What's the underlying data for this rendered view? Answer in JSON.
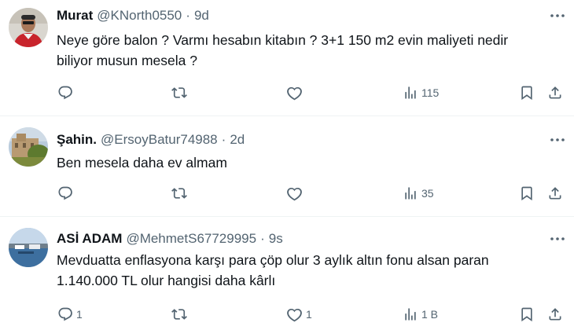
{
  "tweets": [
    {
      "name": "Murat",
      "handle": "@KNorth0550",
      "time": "9d",
      "lines": [
        "Neye göre balon ? Varmı hesabın kitabın ? 3+1 150 m2 evin maliyeti nedir",
        "biliyor musun mesela ?"
      ],
      "reply_count": "",
      "views": "115",
      "avatar": "person-red-shirt"
    },
    {
      "name": "Şahin.",
      "handle": "@ErsoyBatur74988",
      "time": "2d",
      "lines": [
        "Ben mesela daha ev almam"
      ],
      "reply_count": "",
      "views": "35",
      "avatar": "stone-building"
    },
    {
      "name": "ASİ ADAM",
      "handle": "@MehmetS67729995",
      "time": "9s",
      "lines": [
        "Mevduatta enflasyona karşı para çöp olur 3 aylık altın fonu alsan paran",
        "1.140.000 TL olur hangisi daha kârlı"
      ],
      "reply_count": "1",
      "like_count": "1",
      "views": "1 B",
      "avatar": "harbor-boats"
    }
  ],
  "icons": {
    "reply": "reply-icon",
    "retweet": "retweet-icon",
    "like": "heart-icon",
    "views": "views-bar-chart-icon",
    "bookmark": "bookmark-icon",
    "share": "share-icon",
    "more": "more-dots-icon"
  },
  "colors": {
    "text": "#0f1419",
    "secondary": "#536471",
    "divider": "#eff3f4"
  }
}
